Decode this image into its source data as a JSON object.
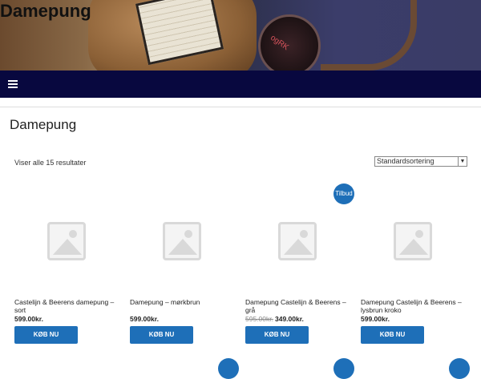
{
  "site": {
    "title": "Damepung"
  },
  "hero": {
    "watch_text": "ogRK"
  },
  "page": {
    "title": "Damepung",
    "result_count": "Viser alle 15 resultater"
  },
  "sort": {
    "selected": "Standardsortering"
  },
  "sale_badge": "Tilbud",
  "products": [
    {
      "name": "Castelijn & Beerens damepung – sort",
      "price": "599.00kr.",
      "old_price": "",
      "button": "KØB NU"
    },
    {
      "name": "Damepung – mørkbrun",
      "price": "599.00kr.",
      "old_price": "",
      "button": "KØB NU"
    },
    {
      "name": "Damepung Castelijn & Beerens – grå",
      "price": "349.00kr.",
      "old_price": "595.00kr.",
      "button": "KØB NU"
    },
    {
      "name": "Damepung Castelijn & Beerens – lysbrun kroko",
      "price": "599.00kr.",
      "old_price": "",
      "button": "KØB NU"
    }
  ],
  "colors": {
    "nav_bg": "#08083f",
    "accent": "#1e6fb8"
  },
  "icons": {
    "menu": "hamburger-icon",
    "placeholder": "image-placeholder-icon"
  }
}
